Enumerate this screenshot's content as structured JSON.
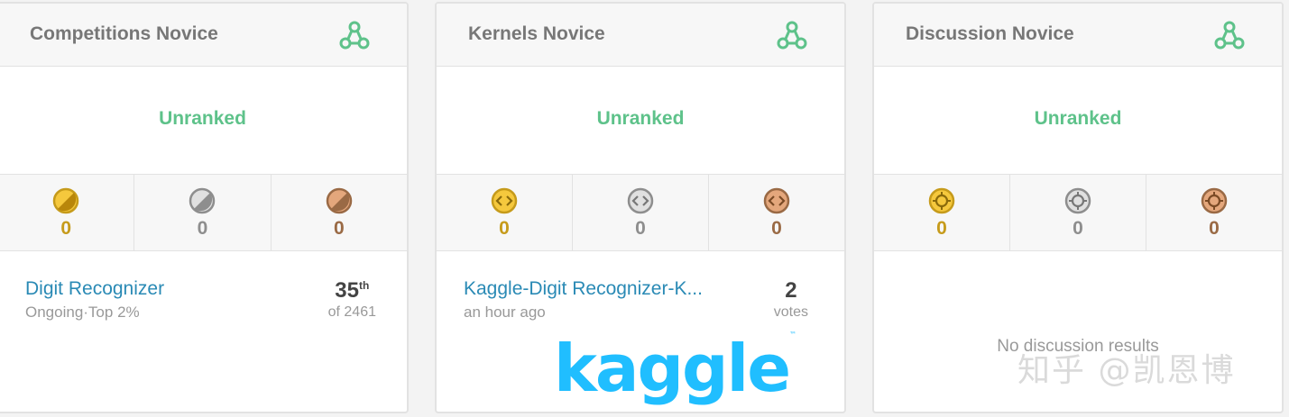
{
  "cards": [
    {
      "title": "Competitions Novice",
      "rank": "Unranked",
      "medals": {
        "gold": "0",
        "silver": "0",
        "bronze": "0"
      },
      "item": {
        "title": "Digit Recognizer",
        "subtitle": "Ongoing·Top 2%",
        "stat_value": "35",
        "stat_suffix": "th",
        "stat_label": "of 2461"
      }
    },
    {
      "title": "Kernels Novice",
      "rank": "Unranked",
      "medals": {
        "gold": "0",
        "silver": "0",
        "bronze": "0"
      },
      "item": {
        "title": "Kaggle-Digit Recognizer-K...",
        "subtitle": "an hour ago",
        "stat_value": "2",
        "stat_label": "votes"
      },
      "logo": {
        "text": "kaggle",
        "mark": "™"
      }
    },
    {
      "title": "Discussion Novice",
      "rank": "Unranked",
      "medals": {
        "gold": "0",
        "silver": "0",
        "bronze": "0"
      },
      "empty_text": "No discussion results"
    }
  ],
  "watermark": "知乎 @凯恩博",
  "icons": {
    "tier": "novice-tier-icon",
    "competition_medal": "competition-medal-icon",
    "kernel_medal": "code-medal-icon",
    "discussion_medal": "discussion-medal-icon"
  },
  "colors": {
    "accent_green": "#5ec28a",
    "link_blue": "#2a8ab5",
    "gold": "#c69b1b",
    "silver": "#8e8e8e",
    "bronze": "#9a6a45",
    "kaggle_blue": "#20beff"
  }
}
